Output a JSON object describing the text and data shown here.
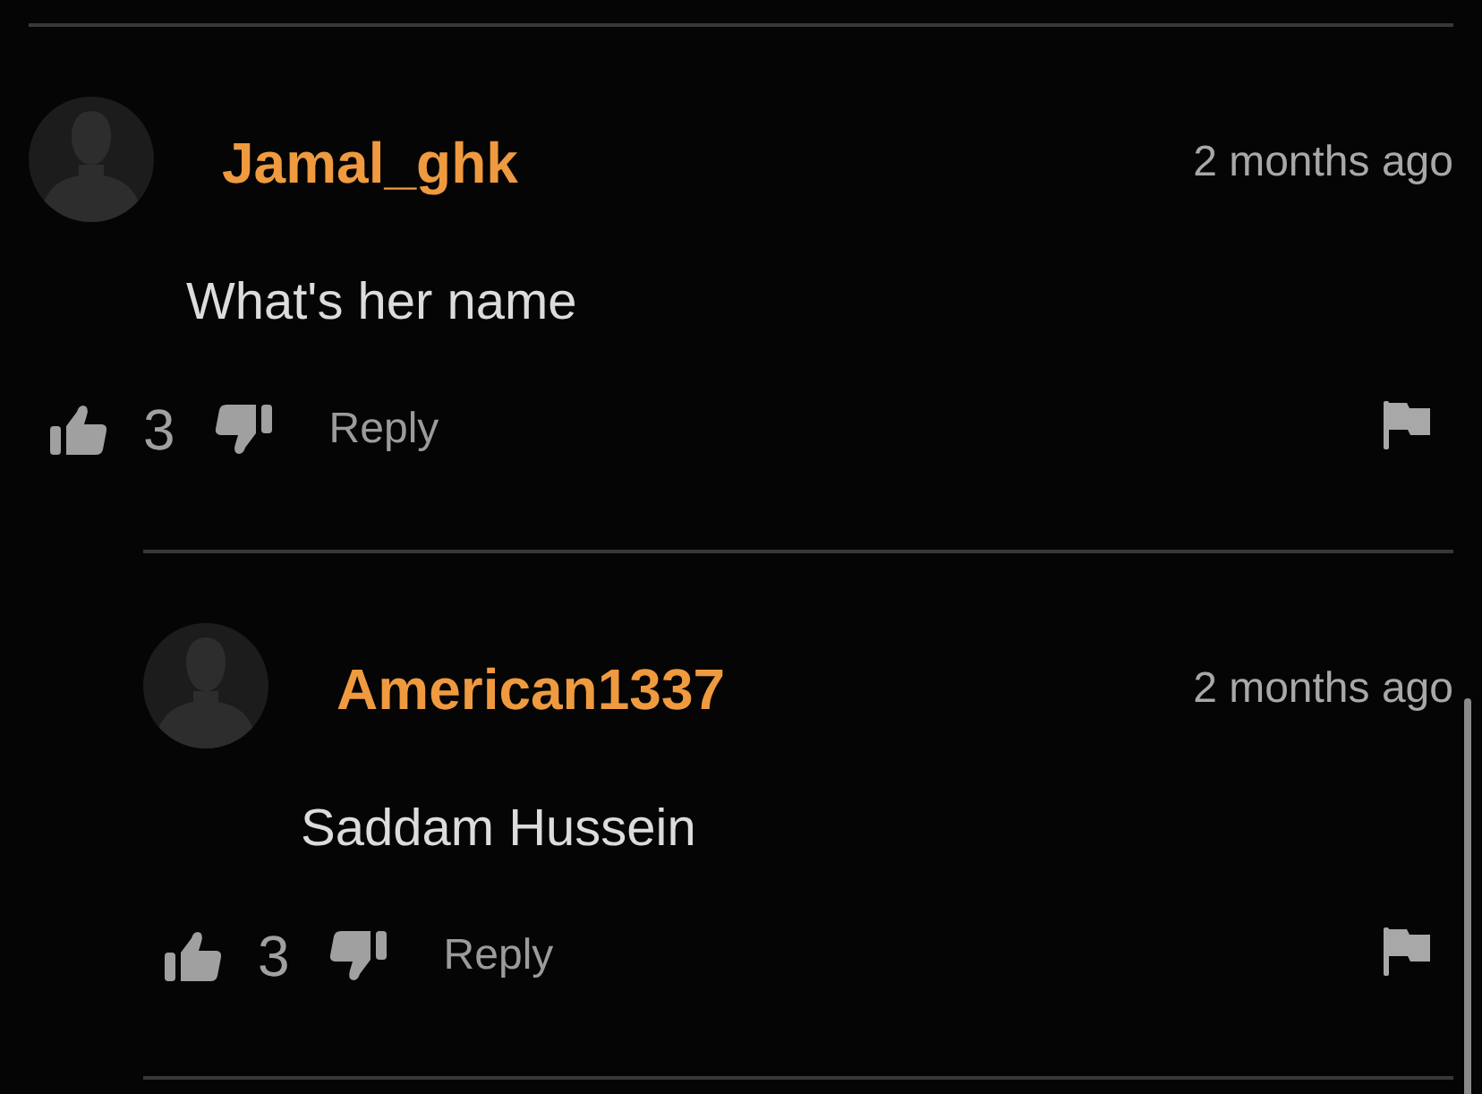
{
  "comments": [
    {
      "author": "Jamal_ghk",
      "time": "2 months ago",
      "text": "What's her name",
      "likes": "3",
      "reply_label": "Reply",
      "replies": [
        {
          "author": "American1337",
          "time": "2 months ago",
          "text": "Saddam Hussein",
          "likes": "3",
          "reply_label": "Reply"
        }
      ]
    }
  ]
}
